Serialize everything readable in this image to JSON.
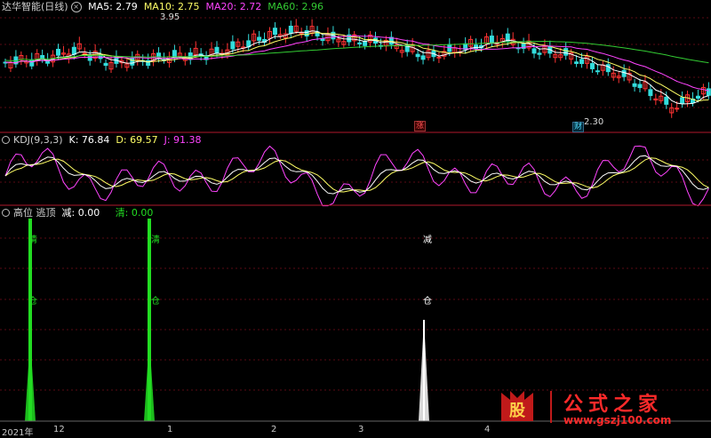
{
  "panel1": {
    "title": "达华智能(日线)",
    "ma5": "MA5: 2.79",
    "ma10": "MA10: 2.75",
    "ma20": "MA20: 2.72",
    "ma60": "MA60: 2.96",
    "high_label": "3.95",
    "low_label": "2.30",
    "marker_zhang": "涨",
    "marker_cai": "财"
  },
  "panel2": {
    "title": "KDJ(9,3,3)",
    "k": "K: 76.84",
    "d": "D: 69.57",
    "j": "J: 91.38"
  },
  "panel3": {
    "title": "高位 逃顶",
    "jian": "减: 0.00",
    "qing": "清: 0.00",
    "signal1_top": "清",
    "signal1_bottom": "仓",
    "signal2_top": "清",
    "signal2_bottom": "仓",
    "signal3_top": "减",
    "signal3_bottom": "仓"
  },
  "xaxis": [
    "2021年",
    "12",
    "1",
    "2",
    "3",
    "4"
  ],
  "watermark": {
    "badge": "股",
    "brand": "公式之家",
    "url": "www.gszj100.com"
  },
  "colors": {
    "ma5": "#ffffff",
    "ma10": "#ffff66",
    "ma20": "#ff44ff",
    "ma60": "#33cc33",
    "up": "#ff3333",
    "down": "#33dddd",
    "qing": "#22dd22",
    "jian": "#ffffff",
    "divider": "#b0182c"
  }
}
